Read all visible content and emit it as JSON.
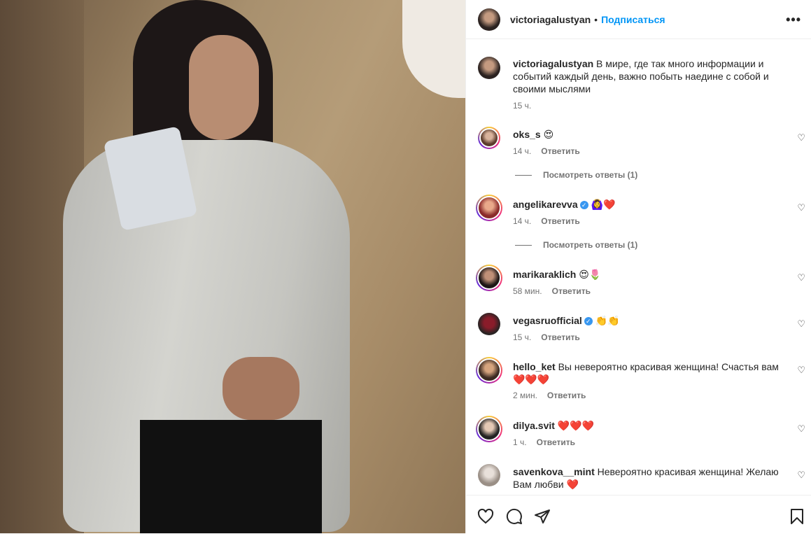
{
  "header": {
    "username": "victoriagalustyan",
    "dot": "•",
    "follow_label": "Подписаться",
    "more": "•••"
  },
  "caption": {
    "username": "victoriagalustyan",
    "text": "В мире, где так много информации и событий каждый день, важно побыть наедине с собой и своими мыслями",
    "time": "15 ч."
  },
  "reply_label": "Ответить",
  "view_replies_label": "Посмотреть ответы (1)",
  "comments": [
    {
      "username": "oks_s",
      "text": "😍",
      "time": "14 ч."
    },
    {
      "username": "angelikarevva",
      "text": "🙆‍♀️❤️",
      "time": "14 ч.",
      "verified": true
    },
    {
      "username": "marikaraklich",
      "text": "😍🌷",
      "time": "58 мин."
    },
    {
      "username": "vegasruofficial",
      "text": "👏👏",
      "time": "15 ч.",
      "verified": true
    },
    {
      "username": "hello_ket",
      "text": "Вы невероятно красивая женщина! Счастья вам ❤️❤️❤️",
      "time": "2 мин."
    },
    {
      "username": "dilya.svit",
      "text": "❤️❤️❤️",
      "time": "1 ч."
    },
    {
      "username": "savenkova__mint",
      "text": "Невероятно красивая женщина! Желаю Вам любви ❤️",
      "time": ""
    }
  ],
  "icons": [
    "heart-icon",
    "comment-icon",
    "share-icon",
    "bookmark-icon"
  ]
}
